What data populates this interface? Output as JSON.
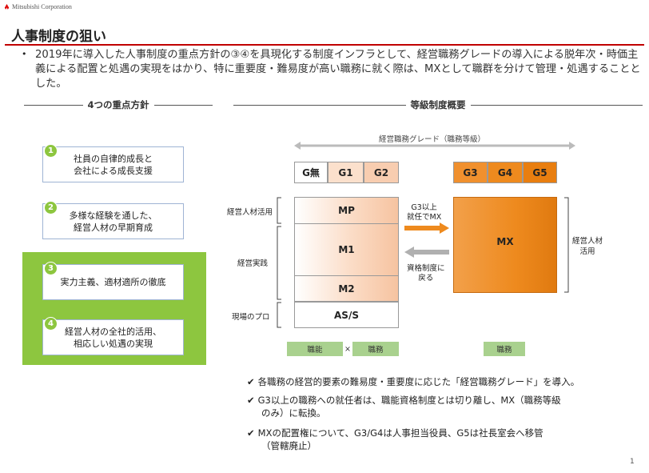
{
  "header": {
    "logo_text": "Mitsubishi Corporation",
    "title": "人事制度の狙い",
    "bullet": "2019年に導入した人事制度の重点方針の③④を具現化する制度インフラとして、経営職務グレードの導入による脱年次・時価主義による配置と処遇の実現をはかり、特に重要度・難易度が高い職務に就く際は、MXとして職群を分けて管理・処遇することとした。"
  },
  "left": {
    "heading": "4つの重点方針",
    "policies": [
      {
        "num": "1",
        "lines": [
          "社員の自律的成長と",
          "会社による成長支援"
        ]
      },
      {
        "num": "2",
        "lines": [
          "多様な経験を通した、",
          "経営人材の早期育成"
        ]
      },
      {
        "num": "3",
        "lines": [
          "実力主義、適材適所の徹底"
        ]
      },
      {
        "num": "4",
        "lines": [
          "経営人材の全社的活用、",
          "相応しい処遇の実現"
        ]
      }
    ]
  },
  "right": {
    "heading": "等級制度概要",
    "grade_axis": "経営職務グレード（職務等級）",
    "grades_left": [
      "G無",
      "G1",
      "G2"
    ],
    "grades_right": [
      "G3",
      "G4",
      "G5"
    ],
    "blocks": [
      "MP",
      "M1",
      "M2",
      "AS/S"
    ],
    "mx": "MX",
    "side_labels": [
      "経営人材活用",
      "経営実践",
      "現場のプロ"
    ],
    "right_label": [
      "経営人材",
      "活用"
    ],
    "arrow_to": [
      "G3以上",
      "就任でMX"
    ],
    "arrow_back": [
      "資格制度に",
      "戻る"
    ],
    "tags": {
      "ability": "職能",
      "times": "×",
      "duty": "職務",
      "duty_right": "職務"
    },
    "notes": [
      [
        "各職務の経営的要素の難易度・重要度に応じた「経営職務グレード」を導入。"
      ],
      [
        "G3以上の職務への就任者は、職能資格制度とは切り離し、MX（職務等級",
        "のみ）に転換。"
      ],
      [
        "MXの配置権について、G3/G4は人事担当役員、G5は社長室会へ移管",
        "（管轄廃止）"
      ]
    ]
  },
  "page_number": "1",
  "colors": {
    "accent_red": "#c00000",
    "green": "#8dc63f",
    "orange": "#ee8a1e",
    "peach": "#f8cdb0"
  }
}
